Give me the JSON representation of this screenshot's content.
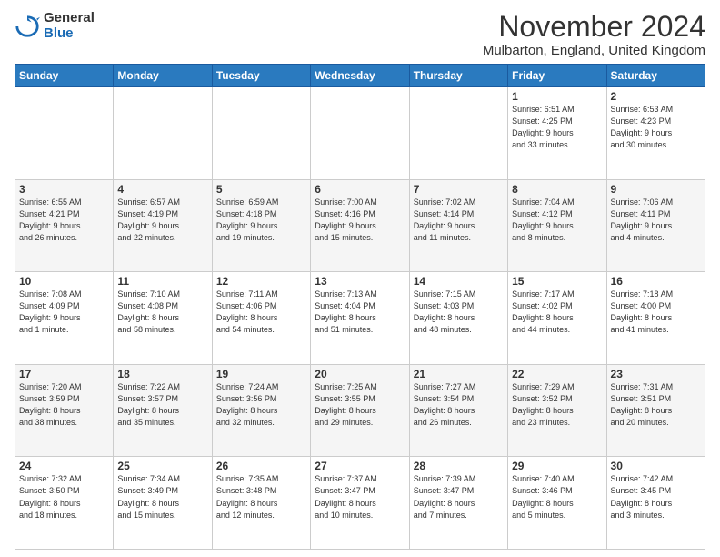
{
  "logo": {
    "general": "General",
    "blue": "Blue"
  },
  "title": "November 2024",
  "subtitle": "Mulbarton, England, United Kingdom",
  "headers": [
    "Sunday",
    "Monday",
    "Tuesday",
    "Wednesday",
    "Thursday",
    "Friday",
    "Saturday"
  ],
  "weeks": [
    [
      {
        "day": "",
        "info": ""
      },
      {
        "day": "",
        "info": ""
      },
      {
        "day": "",
        "info": ""
      },
      {
        "day": "",
        "info": ""
      },
      {
        "day": "",
        "info": ""
      },
      {
        "day": "1",
        "info": "Sunrise: 6:51 AM\nSunset: 4:25 PM\nDaylight: 9 hours\nand 33 minutes."
      },
      {
        "day": "2",
        "info": "Sunrise: 6:53 AM\nSunset: 4:23 PM\nDaylight: 9 hours\nand 30 minutes."
      }
    ],
    [
      {
        "day": "3",
        "info": "Sunrise: 6:55 AM\nSunset: 4:21 PM\nDaylight: 9 hours\nand 26 minutes."
      },
      {
        "day": "4",
        "info": "Sunrise: 6:57 AM\nSunset: 4:19 PM\nDaylight: 9 hours\nand 22 minutes."
      },
      {
        "day": "5",
        "info": "Sunrise: 6:59 AM\nSunset: 4:18 PM\nDaylight: 9 hours\nand 19 minutes."
      },
      {
        "day": "6",
        "info": "Sunrise: 7:00 AM\nSunset: 4:16 PM\nDaylight: 9 hours\nand 15 minutes."
      },
      {
        "day": "7",
        "info": "Sunrise: 7:02 AM\nSunset: 4:14 PM\nDaylight: 9 hours\nand 11 minutes."
      },
      {
        "day": "8",
        "info": "Sunrise: 7:04 AM\nSunset: 4:12 PM\nDaylight: 9 hours\nand 8 minutes."
      },
      {
        "day": "9",
        "info": "Sunrise: 7:06 AM\nSunset: 4:11 PM\nDaylight: 9 hours\nand 4 minutes."
      }
    ],
    [
      {
        "day": "10",
        "info": "Sunrise: 7:08 AM\nSunset: 4:09 PM\nDaylight: 9 hours\nand 1 minute."
      },
      {
        "day": "11",
        "info": "Sunrise: 7:10 AM\nSunset: 4:08 PM\nDaylight: 8 hours\nand 58 minutes."
      },
      {
        "day": "12",
        "info": "Sunrise: 7:11 AM\nSunset: 4:06 PM\nDaylight: 8 hours\nand 54 minutes."
      },
      {
        "day": "13",
        "info": "Sunrise: 7:13 AM\nSunset: 4:04 PM\nDaylight: 8 hours\nand 51 minutes."
      },
      {
        "day": "14",
        "info": "Sunrise: 7:15 AM\nSunset: 4:03 PM\nDaylight: 8 hours\nand 48 minutes."
      },
      {
        "day": "15",
        "info": "Sunrise: 7:17 AM\nSunset: 4:02 PM\nDaylight: 8 hours\nand 44 minutes."
      },
      {
        "day": "16",
        "info": "Sunrise: 7:18 AM\nSunset: 4:00 PM\nDaylight: 8 hours\nand 41 minutes."
      }
    ],
    [
      {
        "day": "17",
        "info": "Sunrise: 7:20 AM\nSunset: 3:59 PM\nDaylight: 8 hours\nand 38 minutes."
      },
      {
        "day": "18",
        "info": "Sunrise: 7:22 AM\nSunset: 3:57 PM\nDaylight: 8 hours\nand 35 minutes."
      },
      {
        "day": "19",
        "info": "Sunrise: 7:24 AM\nSunset: 3:56 PM\nDaylight: 8 hours\nand 32 minutes."
      },
      {
        "day": "20",
        "info": "Sunrise: 7:25 AM\nSunset: 3:55 PM\nDaylight: 8 hours\nand 29 minutes."
      },
      {
        "day": "21",
        "info": "Sunrise: 7:27 AM\nSunset: 3:54 PM\nDaylight: 8 hours\nand 26 minutes."
      },
      {
        "day": "22",
        "info": "Sunrise: 7:29 AM\nSunset: 3:52 PM\nDaylight: 8 hours\nand 23 minutes."
      },
      {
        "day": "23",
        "info": "Sunrise: 7:31 AM\nSunset: 3:51 PM\nDaylight: 8 hours\nand 20 minutes."
      }
    ],
    [
      {
        "day": "24",
        "info": "Sunrise: 7:32 AM\nSunset: 3:50 PM\nDaylight: 8 hours\nand 18 minutes."
      },
      {
        "day": "25",
        "info": "Sunrise: 7:34 AM\nSunset: 3:49 PM\nDaylight: 8 hours\nand 15 minutes."
      },
      {
        "day": "26",
        "info": "Sunrise: 7:35 AM\nSunset: 3:48 PM\nDaylight: 8 hours\nand 12 minutes."
      },
      {
        "day": "27",
        "info": "Sunrise: 7:37 AM\nSunset: 3:47 PM\nDaylight: 8 hours\nand 10 minutes."
      },
      {
        "day": "28",
        "info": "Sunrise: 7:39 AM\nSunset: 3:47 PM\nDaylight: 8 hours\nand 7 minutes."
      },
      {
        "day": "29",
        "info": "Sunrise: 7:40 AM\nSunset: 3:46 PM\nDaylight: 8 hours\nand 5 minutes."
      },
      {
        "day": "30",
        "info": "Sunrise: 7:42 AM\nSunset: 3:45 PM\nDaylight: 8 hours\nand 3 minutes."
      }
    ]
  ]
}
